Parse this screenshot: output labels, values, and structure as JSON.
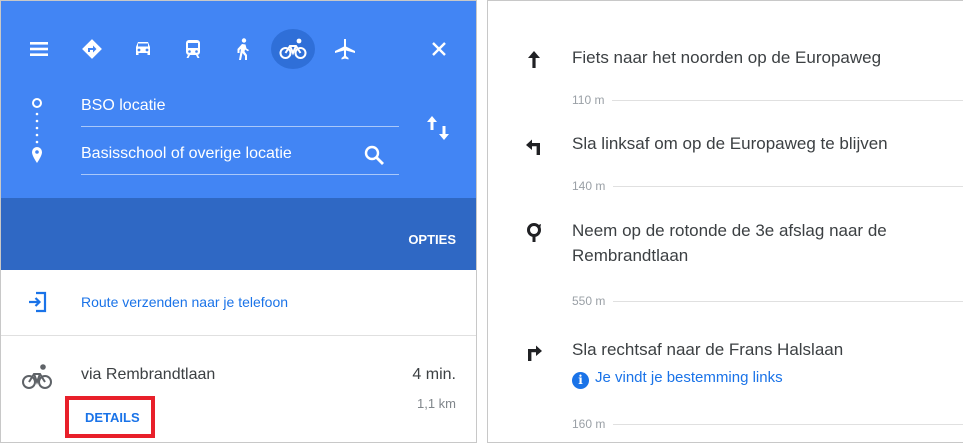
{
  "left_panel": {
    "from_value": "BSO locatie",
    "to_value": "Basisschool of overige locatie",
    "options_label": "OPTIES",
    "send_route_label": "Route verzenden naar je telefoon",
    "route": {
      "via": "via Rembrandtlaan",
      "duration": "4 min.",
      "distance": "1,1 km",
      "details_label": "DETAILS"
    },
    "travel_modes": [
      "menu-icon",
      "directions-icon",
      "car-icon",
      "transit-icon",
      "walk-icon",
      "bicycle-icon",
      "flight-icon"
    ],
    "active_mode": "bicycle",
    "colors": {
      "header": "#4285f4",
      "options_bar": "#2f68c4",
      "link": "#1a73e8",
      "highlight_box": "#e8202a"
    }
  },
  "directions": {
    "steps": [
      {
        "icon": "arrow-up-icon",
        "text": "Fiets naar het noorden op de Europaweg",
        "distance": "110 m"
      },
      {
        "icon": "turn-left-icon",
        "text": "Sla linksaf om op de Europaweg te blijven",
        "distance": "140 m"
      },
      {
        "icon": "roundabout-icon",
        "text": "Neem op de rotonde de 3e afslag naar de Rembrandtlaan",
        "distance": "550 m"
      },
      {
        "icon": "turn-right-icon",
        "text": "Sla rechtsaf naar de Frans Halslaan",
        "note": "Je vindt je bestemming links",
        "distance": "160 m"
      }
    ]
  }
}
